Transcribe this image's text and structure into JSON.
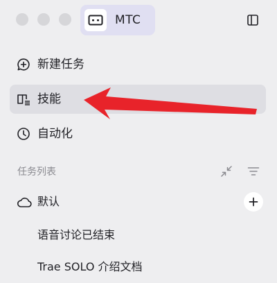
{
  "app": {
    "name": "MTC"
  },
  "nav": {
    "items": [
      {
        "label": "新建任务",
        "icon": "chat-plus-icon"
      },
      {
        "label": "技能",
        "icon": "book-icon",
        "active": true
      },
      {
        "label": "自动化",
        "icon": "clock-icon"
      }
    ]
  },
  "task_list": {
    "title": "任务列表",
    "group": {
      "label": "默认",
      "icon": "cloud-icon"
    },
    "tasks": [
      "语音讨论已结束",
      "Trae SOLO 介绍文档"
    ]
  },
  "colors": {
    "active_bg": "#dedee3",
    "app_chip_bg": "#e0dff2",
    "arrow": "#e8232a"
  }
}
